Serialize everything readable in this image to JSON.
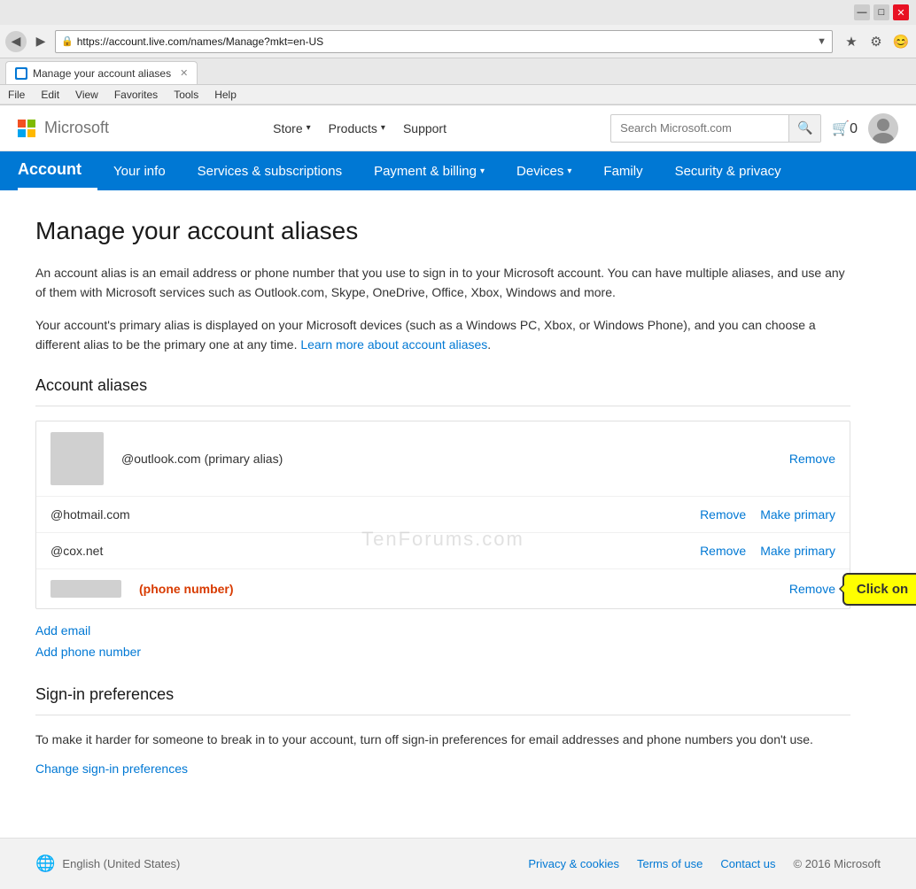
{
  "browser": {
    "url": "https://account.live.com/names/Manage?mkt=en-US",
    "tab_title": "Manage your account aliases",
    "title_bar_buttons": [
      "minimize",
      "maximize",
      "close"
    ],
    "menu_items": [
      "File",
      "Edit",
      "View",
      "Favorites",
      "Tools",
      "Help"
    ]
  },
  "ms_nav": {
    "logo_text": "Microsoft",
    "nav_items": [
      {
        "label": "Store",
        "has_dropdown": true
      },
      {
        "label": "Products",
        "has_dropdown": true
      },
      {
        "label": "Support",
        "has_dropdown": false
      }
    ],
    "search_placeholder": "Search Microsoft.com",
    "cart_label": "0"
  },
  "account_nav": {
    "brand_label": "Account",
    "items": [
      {
        "label": "Your info"
      },
      {
        "label": "Services & subscriptions"
      },
      {
        "label": "Payment & billing",
        "has_dropdown": true
      },
      {
        "label": "Devices",
        "has_dropdown": true
      },
      {
        "label": "Family"
      },
      {
        "label": "Security & privacy"
      }
    ]
  },
  "page": {
    "title": "Manage your account aliases",
    "description1": "An account alias is an email address or phone number that you use to sign in to your Microsoft account. You can have multiple aliases, and use any of them with Microsoft services such as Outlook.com, Skype, OneDrive, Office, Xbox, Windows and more.",
    "description2_part1": "Your account's primary alias is displayed on your Microsoft devices (such as a Windows PC, Xbox, or Windows Phone), and you can choose a different alias to be the primary one at any time.",
    "description2_link": "Learn more about account aliases",
    "description2_link_href": "#"
  },
  "aliases_section": {
    "title": "Account aliases",
    "aliases": [
      {
        "email": "@outlook.com (primary alias)",
        "is_primary": true,
        "actions": [
          "Remove"
        ]
      },
      {
        "email": "@hotmail.com",
        "is_primary": false,
        "actions": [
          "Remove",
          "Make primary"
        ]
      },
      {
        "email": "@cox.net",
        "is_primary": false,
        "actions": [
          "Remove",
          "Make primary"
        ]
      },
      {
        "type": "phone",
        "display": "(phone number)",
        "actions": [
          "Remove"
        ],
        "has_tooltip": true
      }
    ],
    "add_email_label": "Add email",
    "add_phone_label": "Add phone number",
    "tooltip_label": "Click on"
  },
  "signin_section": {
    "title": "Sign-in preferences",
    "description": "To make it harder for someone to break in to your account, turn off sign-in preferences for email addresses and phone numbers you don't use.",
    "link_label": "Change sign-in preferences"
  },
  "footer": {
    "language": "English (United States)",
    "links": [
      {
        "label": "Privacy & cookies"
      },
      {
        "label": "Terms of use"
      },
      {
        "label": "Contact us"
      }
    ],
    "copyright": "© 2016 Microsoft"
  },
  "watermark": "TenForums.com"
}
